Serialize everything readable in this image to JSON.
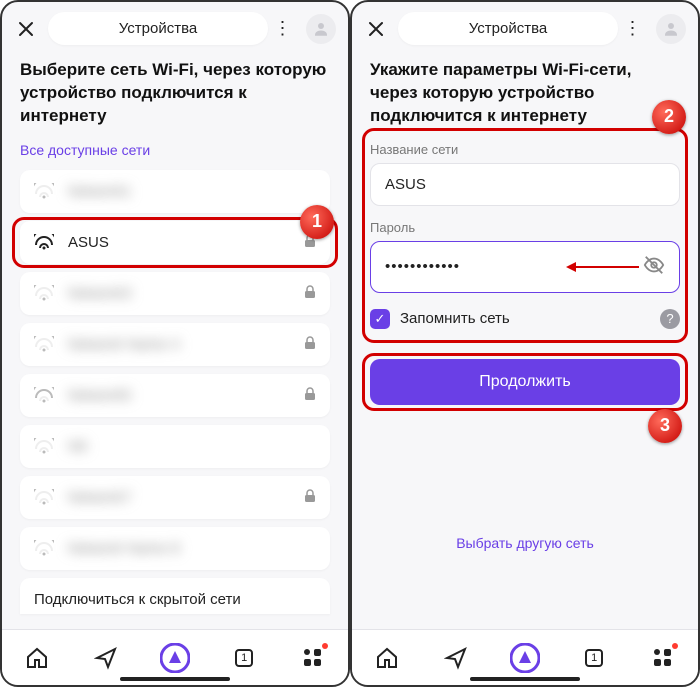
{
  "left": {
    "header": {
      "title": "Устройства"
    },
    "heading": "Выберите сеть Wi-Fi, через которую устройство подключится к интернету",
    "subhead": "Все доступные сети",
    "networks": [
      {
        "name": "Network1",
        "locked": false,
        "blurred": true,
        "signal": 2
      },
      {
        "name": "ASUS",
        "locked": true,
        "blurred": false,
        "signal": 4,
        "highlighted": true
      },
      {
        "name": "Network3",
        "locked": true,
        "blurred": true,
        "signal": 2
      },
      {
        "name": "Network Name 4",
        "locked": true,
        "blurred": true,
        "signal": 2
      },
      {
        "name": "Network5",
        "locked": true,
        "blurred": true,
        "signal": 3
      },
      {
        "name": "N6",
        "locked": false,
        "blurred": true,
        "signal": 2
      },
      {
        "name": "Network7",
        "locked": true,
        "blurred": true,
        "signal": 2
      },
      {
        "name": "Network Name 8",
        "locked": false,
        "blurred": true,
        "signal": 2
      }
    ],
    "hidden_link": "Подключиться к скрытой сети",
    "step_badge": "1"
  },
  "right": {
    "header": {
      "title": "Устройства"
    },
    "heading": "Укажите параметры Wi-Fi-сети, через которую устройство подключится к интернету",
    "ssid_label": "Название сети",
    "ssid_value": "ASUS",
    "pwd_label": "Пароль",
    "pwd_value": "••••••••••••",
    "remember_label": "Запомнить сеть",
    "cta": "Продолжить",
    "alt_link": "Выбрать другую сеть",
    "step_form": "2",
    "step_cta": "3"
  },
  "nav": {
    "tab_count": "1"
  }
}
